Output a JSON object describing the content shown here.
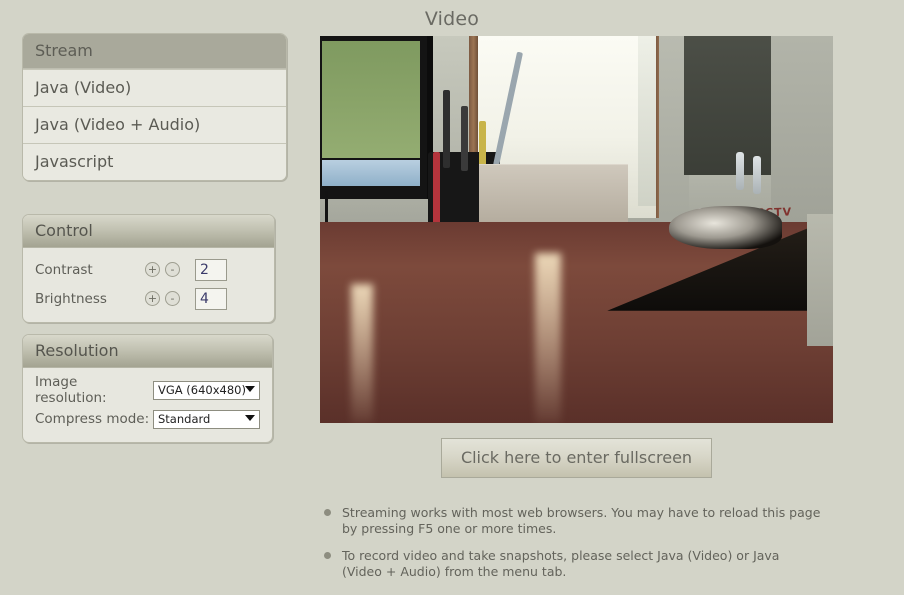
{
  "page": {
    "title": "Video",
    "background_color": "#d3d4c8"
  },
  "stream_menu": {
    "header": "Stream",
    "items": [
      {
        "label": "Java (Video)"
      },
      {
        "label": "Java (Video + Audio)"
      },
      {
        "label": "Javascript"
      }
    ]
  },
  "control_panel": {
    "header": "Control",
    "rows": [
      {
        "label": "Contrast",
        "value": "2",
        "increase": "+",
        "decrease": "-"
      },
      {
        "label": "Brightness",
        "value": "4",
        "increase": "+",
        "decrease": "-"
      }
    ]
  },
  "resolution_panel": {
    "header": "Resolution",
    "rows": [
      {
        "label": "Image resolution:",
        "value": "VGA (640x480)"
      },
      {
        "label": "Compress mode:",
        "value": "Standard"
      }
    ]
  },
  "video": {
    "alt": "Live camera view of a desk with a monitor, pen cup, CCTV labeled box, a window and a toy car on a wall shelf"
  },
  "fullscreen_button": {
    "label": "Click here to enter fullscreen"
  },
  "notes": [
    {
      "text": "Streaming works with most web browsers. You may have to reload this page by pressing F5 one or more times."
    },
    {
      "text": "To record video and take snapshots, please select Java (Video) or Java (Video + Audio) from the menu tab."
    }
  ]
}
